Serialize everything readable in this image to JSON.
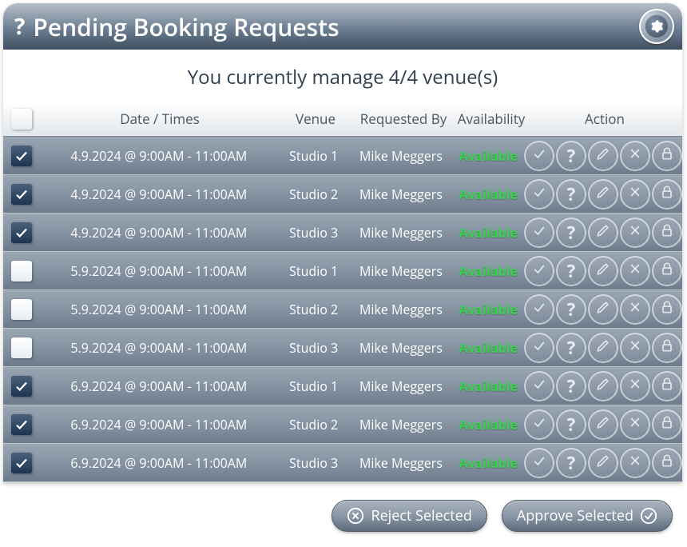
{
  "header": {
    "help_icon": "?",
    "title": "Pending Booking Requests",
    "gear_icon": "gear"
  },
  "subheader": "You currently manage 4/4 venue(s)",
  "columns": {
    "date": "Date / Times",
    "venue": "Venue",
    "requested_by": "Requested By",
    "availability": "Availability",
    "action": "Action"
  },
  "rows": [
    {
      "checked": true,
      "date": "4.9.2024 @ 9:00AM - 11:00AM",
      "venue": "Studio 1",
      "requested_by": "Mike Meggers",
      "availability": "Available"
    },
    {
      "checked": true,
      "date": "4.9.2024 @ 9:00AM - 11:00AM",
      "venue": "Studio 2",
      "requested_by": "Mike Meggers",
      "availability": "Available"
    },
    {
      "checked": true,
      "date": "4.9.2024 @ 9:00AM - 11:00AM",
      "venue": "Studio 3",
      "requested_by": "Mike Meggers",
      "availability": "Available"
    },
    {
      "checked": false,
      "date": "5.9.2024 @ 9:00AM - 11:00AM",
      "venue": "Studio 1",
      "requested_by": "Mike Meggers",
      "availability": "Available"
    },
    {
      "checked": false,
      "date": "5.9.2024 @ 9:00AM - 11:00AM",
      "venue": "Studio 2",
      "requested_by": "Mike Meggers",
      "availability": "Available"
    },
    {
      "checked": false,
      "date": "5.9.2024 @ 9:00AM - 11:00AM",
      "venue": "Studio 3",
      "requested_by": "Mike Meggers",
      "availability": "Available"
    },
    {
      "checked": true,
      "date": "6.9.2024 @ 9:00AM - 11:00AM",
      "venue": "Studio 1",
      "requested_by": "Mike Meggers",
      "availability": "Available"
    },
    {
      "checked": true,
      "date": "6.9.2024 @ 9:00AM - 11:00AM",
      "venue": "Studio 2",
      "requested_by": "Mike Meggers",
      "availability": "Available"
    },
    {
      "checked": true,
      "date": "6.9.2024 @ 9:00AM - 11:00AM",
      "venue": "Studio 3",
      "requested_by": "Mike Meggers",
      "availability": "Available"
    }
  ],
  "row_action_icons": [
    "check",
    "question",
    "pencil",
    "cross",
    "lock"
  ],
  "footer": {
    "reject_label": "Reject Selected",
    "approve_label": "Approve Selected"
  }
}
